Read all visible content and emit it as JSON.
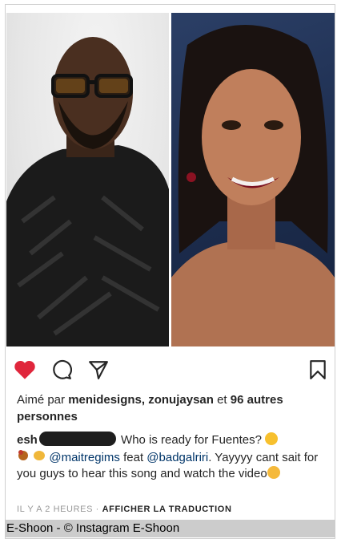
{
  "post": {
    "likes": {
      "prefix": "Aimé par",
      "users": "menidesigns, zonujaysan",
      "connector": "et",
      "count": "96",
      "suffix": "autres personnes"
    },
    "caption": {
      "username_visible": "esh",
      "text_1": "Who is ready for Fuentes?",
      "mention_1": "@maitregims",
      "text_2": "feat",
      "mention_2": "@badgalriri",
      "text_3": ". Yayyyy cant sait for you guys to hear this song and watch the video"
    },
    "timestamp": "IL Y A 2 HEURES",
    "separator": "·",
    "translate_label": "AFFICHER LA TRADUCTION"
  },
  "icons": {
    "like": "heart-icon",
    "comment": "comment-icon",
    "share": "send-icon",
    "save": "bookmark-icon"
  },
  "colors": {
    "like_active": "#e0263c",
    "mention": "#003569",
    "muted": "#999999"
  },
  "credit": "E-Shoon - © Instagram E-Shoon"
}
